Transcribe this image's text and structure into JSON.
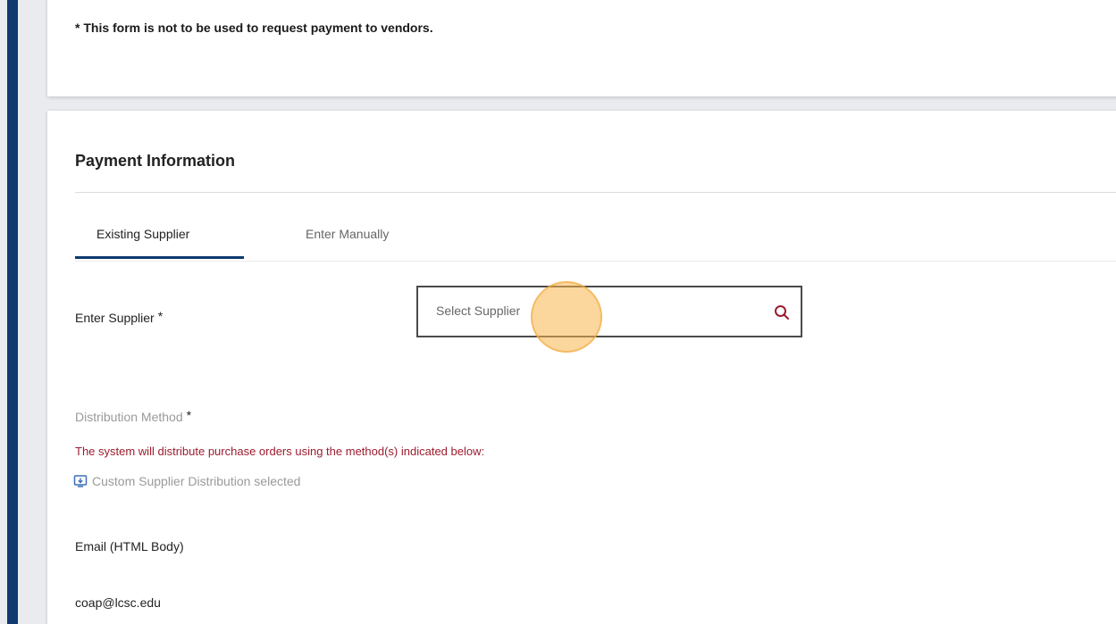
{
  "notice": {
    "text": "* This form is not to be used to request payment to vendors."
  },
  "payment_section": {
    "title": "Payment Information",
    "tabs": [
      {
        "label": "Existing Supplier",
        "active": true
      },
      {
        "label": "Enter Manually",
        "active": false
      }
    ],
    "supplier_field": {
      "label": "Enter Supplier",
      "required_mark": "*",
      "placeholder": "Select Supplier",
      "value": "",
      "icon": "search-icon"
    },
    "distribution": {
      "label": "Distribution Method",
      "required_mark": "*",
      "note": "The system will distribute purchase orders using the method(s) indicated below:",
      "custom_text": "Custom Supplier Distribution selected",
      "custom_icon": "distribution-icon",
      "method": "Email (HTML Body)",
      "email": "coap@lcsc.edu"
    }
  },
  "colors": {
    "accent": "#0e3a6e",
    "note_red": "#9b1c2e",
    "muted": "#9a9a9a",
    "search_icon": "#9b1c2e",
    "click_indicator": "#f7b54c"
  }
}
